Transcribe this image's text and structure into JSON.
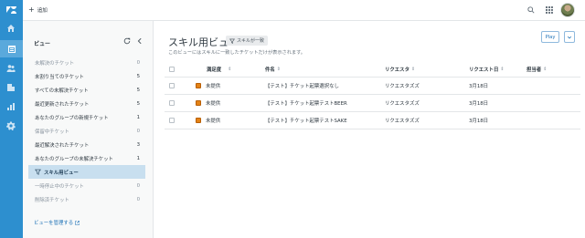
{
  "topbar": {
    "add_label": "追加"
  },
  "sidebar_icons": [
    "zendesk-logo",
    "home-icon",
    "views-icon",
    "customers-icon",
    "organizations-icon",
    "reporting-icon",
    "admin-gear-icon"
  ],
  "views": {
    "heading": "ビュー",
    "items": [
      {
        "label": "未解決のチケット",
        "count": "0"
      },
      {
        "label": "未割り当てのチケット",
        "count": "5"
      },
      {
        "label": "すべての未解決チケット",
        "count": "5"
      },
      {
        "label": "最近更新されたチケット",
        "count": "5"
      },
      {
        "label": "あなたのグループの新規チケット",
        "count": "1"
      },
      {
        "label": "保留中チケット",
        "count": "0"
      },
      {
        "label": "最近解決されたチケット",
        "count": "3"
      },
      {
        "label": "あなたのグループの未解決チケット",
        "count": "1"
      },
      {
        "label": "スキル用ビュー",
        "count": ""
      },
      {
        "label": "一時停止中のチケット",
        "count": "0"
      },
      {
        "label": "削除済チケット",
        "count": "0"
      }
    ],
    "manage_link": "ビューを管理する"
  },
  "main": {
    "title": "スキル用ビュー",
    "tag_label": "スキルが一致",
    "subtitle": "このビューにはスキルに一致したチケットだけが表示されます。",
    "play_label": "Play",
    "columns": {
      "status": "満足度",
      "subject": "件名",
      "requester": "リクエスタ",
      "requested": "リクエスト日",
      "assignee": "担当者"
    },
    "rows": [
      {
        "status": "未提供",
        "subject": "【テスト】チケット起票選択なし",
        "requester": "リクエスタズズ",
        "requested": "3月18日",
        "assignee": ""
      },
      {
        "status": "未提供",
        "subject": "【テスト】チケット起票テストBEER",
        "requester": "リクエスタズズ",
        "requested": "3月18日",
        "assignee": ""
      },
      {
        "status": "未提供",
        "subject": "【テスト】チケット起票テストSAKE",
        "requester": "リクエスタズズ",
        "requested": "3月18日",
        "assignee": ""
      }
    ]
  },
  "colors": {
    "rail": "#2d8fcf",
    "active_view": "#c8dfef",
    "link": "#1f73b7",
    "status_square": "#e38215"
  }
}
